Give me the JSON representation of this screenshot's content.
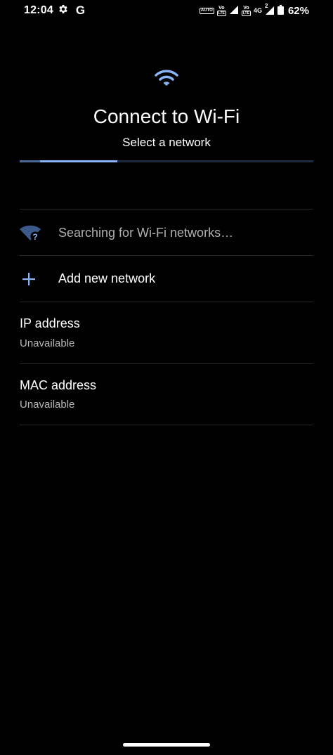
{
  "status_bar": {
    "time": "12:04",
    "google_letter": "G",
    "auto_badge": "AUTO",
    "volte_1": "VoLTE",
    "volte_1_top": "Vo",
    "volte_1_bottom": "LTE",
    "network_4g": "4G",
    "volte_2_top": "Vo",
    "volte_2_bottom": "LTE",
    "sim2": "2",
    "battery_percent": "62%",
    "icons": [
      "settings-gear-icon",
      "google-g-icon",
      "auto-sync-icon",
      "volte-icon",
      "signal-icon",
      "signal-icon",
      "battery-icon"
    ]
  },
  "header": {
    "icon": "wifi-icon",
    "accent_color": "#8ab4f8",
    "title": "Connect to Wi-Fi",
    "subtitle": "Select a network",
    "progress": 0.33
  },
  "network_list": {
    "searching_icon": "wifi-question-icon",
    "searching_text": "Searching for Wi-Fi networks…",
    "add_icon": "plus-icon",
    "add_text": "Add new network"
  },
  "info": {
    "ip_label": "IP address",
    "ip_value": "Unavailable",
    "mac_label": "MAC address",
    "mac_value": "Unavailable"
  }
}
